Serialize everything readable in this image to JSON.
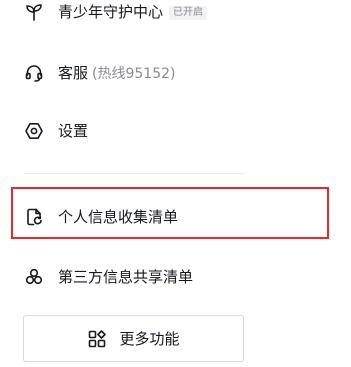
{
  "menu": {
    "youth": {
      "label": "青少年守护中心",
      "badge": "已开启",
      "icon": "sprout-icon"
    },
    "service": {
      "label": "客服",
      "hotline": "(热线95152)",
      "icon": "headset-icon"
    },
    "settings": {
      "label": "设置",
      "icon": "hexagon-gear-icon"
    },
    "personal_info": {
      "label": "个人信息收集清单",
      "icon": "document-refresh-icon"
    },
    "third_party": {
      "label": "第三方信息共享清单",
      "icon": "three-circles-icon"
    }
  },
  "more_button": {
    "label": "更多功能",
    "icon": "grid-icon"
  },
  "highlight_color": "#e8282b"
}
